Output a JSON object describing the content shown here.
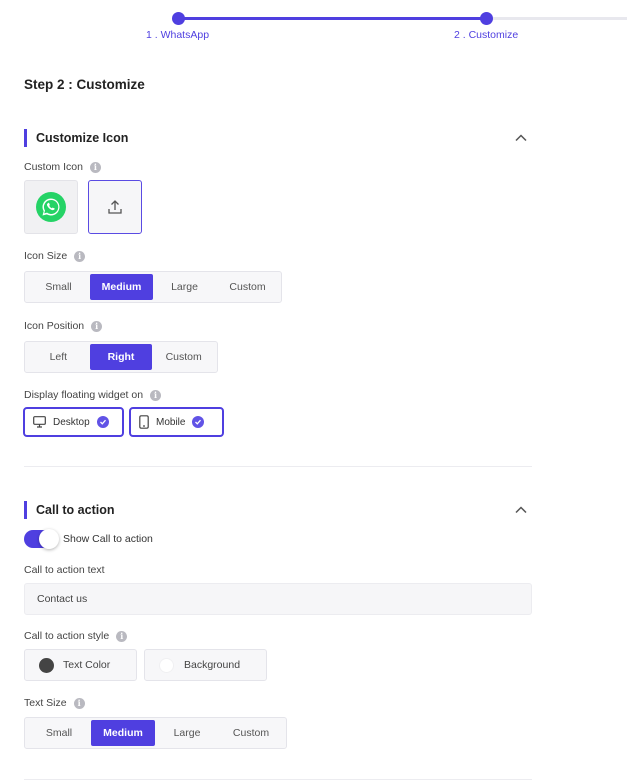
{
  "stepper": {
    "steps": [
      {
        "label": "1 . WhatsApp"
      },
      {
        "label": "2 . Customize"
      }
    ]
  },
  "page": {
    "title": "Step 2 : Customize"
  },
  "customize_icon": {
    "title": "Customize Icon",
    "custom_icon_label": "Custom Icon",
    "icon_size": {
      "label": "Icon Size",
      "options": [
        "Small",
        "Medium",
        "Large",
        "Custom"
      ],
      "selected": "Medium"
    },
    "icon_position": {
      "label": "Icon Position",
      "options": [
        "Left",
        "Right",
        "Custom"
      ],
      "selected": "Right"
    },
    "display_on": {
      "label": "Display floating widget on",
      "desktop": "Desktop",
      "mobile": "Mobile"
    }
  },
  "call_to_action": {
    "title": "Call to action",
    "toggle_label": "Show Call to action",
    "text_label": "Call to action text",
    "text_value": "Contact us",
    "style": {
      "label": "Call to action style",
      "text_color": "Text Color",
      "background": "Background",
      "text_color_value": "#444444",
      "background_value": "#ffffff"
    },
    "text_size": {
      "label": "Text Size",
      "options": [
        "Small",
        "Medium",
        "Large",
        "Custom"
      ],
      "selected": "Medium"
    }
  },
  "colors": {
    "accent": "#4f3fe0",
    "whatsapp_green": "#25d366"
  },
  "icons": {
    "info": "info-icon",
    "chevron": "chevron-up-icon",
    "upload": "upload-icon",
    "whatsapp": "whatsapp-icon",
    "desktop": "desktop-icon",
    "mobile": "mobile-icon",
    "check": "check-circle-icon"
  }
}
